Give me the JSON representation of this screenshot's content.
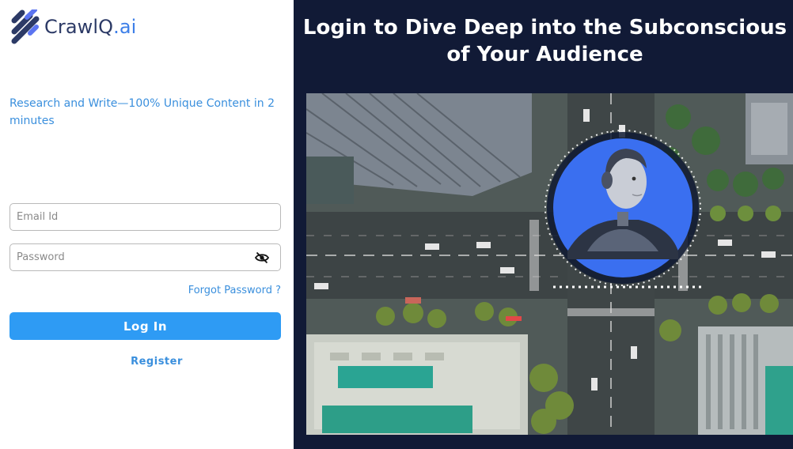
{
  "brand": {
    "name": "CrawlQ",
    "suffix": ".ai"
  },
  "tagline": "Research and Write—100% Unique Content in 2 minutes",
  "form": {
    "email_placeholder": "Email Id",
    "password_placeholder": "Password",
    "forgot_password": "Forgot Password ?",
    "login_button": "Log In",
    "register_link": "Register"
  },
  "hero": {
    "title": "Login to Dive Deep into the Subconscious of Your Audience"
  },
  "icons": {
    "logo": "crawlq-logo-icon",
    "password_toggle": "eye-slash-icon"
  },
  "colors": {
    "accent": "#2e9bf4",
    "link": "#3a8fdd",
    "hero_background": "#111a36",
    "brand_dark": "#2c3a66"
  }
}
